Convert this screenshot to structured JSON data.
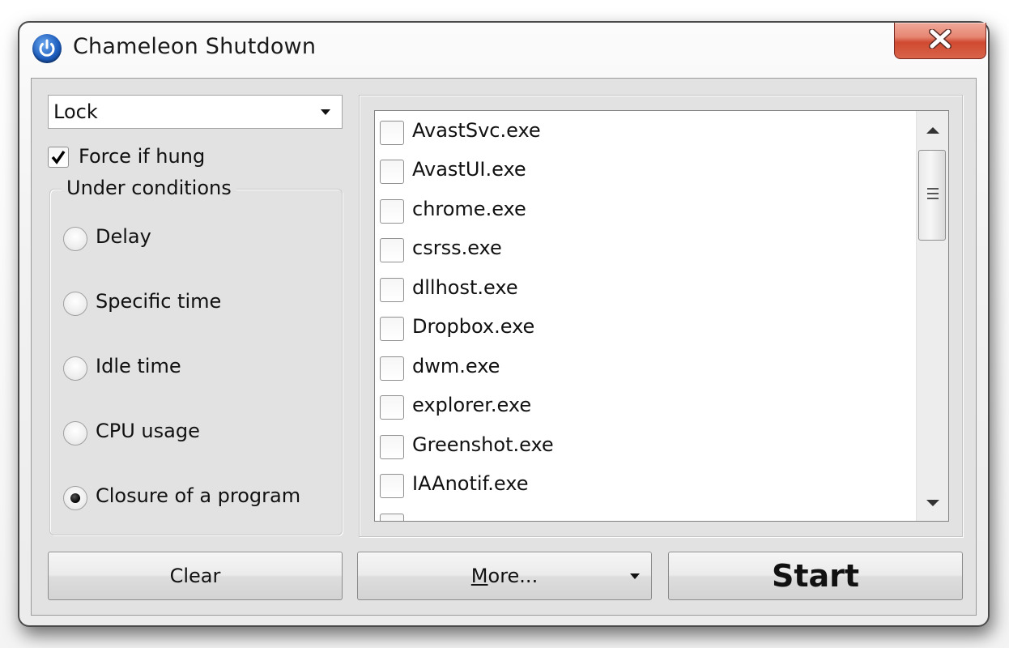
{
  "window": {
    "title": "Chameleon Shutdown",
    "icon": "power-icon",
    "close_icon": "close-icon"
  },
  "action_select": {
    "value": "Lock"
  },
  "force_if_hung": {
    "label": "Force if hung",
    "checked": true
  },
  "conditions": {
    "legend": "Under conditions",
    "options": [
      {
        "label": "Delay",
        "selected": false
      },
      {
        "label": "Specific time",
        "selected": false
      },
      {
        "label": "Idle time",
        "selected": false
      },
      {
        "label": "CPU usage",
        "selected": false
      },
      {
        "label": "Closure of a program",
        "selected": true
      }
    ]
  },
  "process_list": {
    "items": [
      {
        "name": "AvastSvc.exe",
        "checked": false
      },
      {
        "name": "AvastUI.exe",
        "checked": false
      },
      {
        "name": "chrome.exe",
        "checked": false
      },
      {
        "name": "csrss.exe",
        "checked": false
      },
      {
        "name": "dllhost.exe",
        "checked": false
      },
      {
        "name": "Dropbox.exe",
        "checked": false
      },
      {
        "name": "dwm.exe",
        "checked": false
      },
      {
        "name": "explorer.exe",
        "checked": false
      },
      {
        "name": "Greenshot.exe",
        "checked": false
      },
      {
        "name": "IAAnotif.exe",
        "checked": false
      }
    ]
  },
  "buttons": {
    "clear": "Clear",
    "more_accel": "M",
    "more_rest": "ore...",
    "start": "Start"
  }
}
